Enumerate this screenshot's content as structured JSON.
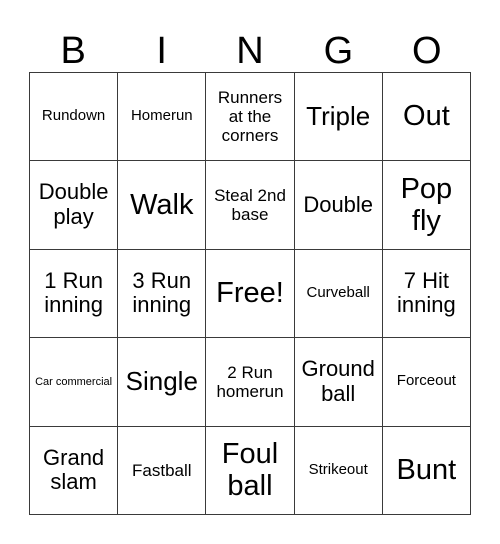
{
  "card": {
    "title": "BINGO",
    "header_letters": [
      "B",
      "I",
      "N",
      "G",
      "O"
    ],
    "colors": {
      "background": "#ffffff",
      "border": "#3a3a3a",
      "text": "#000000"
    },
    "grid_size": "5x5",
    "free_space": "Free!",
    "cells": [
      {
        "label": "Rundown",
        "size": "sm",
        "row": 1,
        "col": 1
      },
      {
        "label": "Homerun",
        "size": "sm",
        "row": 1,
        "col": 2
      },
      {
        "label": "Runners at the corners",
        "size": "md",
        "row": 1,
        "col": 3
      },
      {
        "label": "Triple",
        "size": "xl",
        "row": 1,
        "col": 4
      },
      {
        "label": "Out",
        "size": "xxl",
        "row": 1,
        "col": 5
      },
      {
        "label": "Double play",
        "size": "lg",
        "row": 2,
        "col": 1
      },
      {
        "label": "Walk",
        "size": "xxl",
        "row": 2,
        "col": 2
      },
      {
        "label": "Steal 2nd base",
        "size": "md",
        "row": 2,
        "col": 3
      },
      {
        "label": "Double",
        "size": "lg",
        "row": 2,
        "col": 4
      },
      {
        "label": "Pop fly",
        "size": "xxl",
        "row": 2,
        "col": 5
      },
      {
        "label": "1 Run inning",
        "size": "lg",
        "row": 3,
        "col": 1
      },
      {
        "label": "3 Run inning",
        "size": "lg",
        "row": 3,
        "col": 2
      },
      {
        "label": "Free!",
        "size": "xxl",
        "row": 3,
        "col": 3
      },
      {
        "label": "Curveball",
        "size": "sm",
        "row": 3,
        "col": 4
      },
      {
        "label": "7 Hit inning",
        "size": "lg",
        "row": 3,
        "col": 5
      },
      {
        "label": "Car commercial",
        "size": "xs",
        "row": 4,
        "col": 1
      },
      {
        "label": "Single",
        "size": "xl",
        "row": 4,
        "col": 2
      },
      {
        "label": "2 Run homerun",
        "size": "md",
        "row": 4,
        "col": 3
      },
      {
        "label": "Ground ball",
        "size": "lg",
        "row": 4,
        "col": 4
      },
      {
        "label": "Forceout",
        "size": "sm",
        "row": 4,
        "col": 5
      },
      {
        "label": "Grand slam",
        "size": "lg",
        "row": 5,
        "col": 1
      },
      {
        "label": "Fastball",
        "size": "md",
        "row": 5,
        "col": 2
      },
      {
        "label": "Foul ball",
        "size": "xxl",
        "row": 5,
        "col": 3
      },
      {
        "label": "Strikeout",
        "size": "sm",
        "row": 5,
        "col": 4
      },
      {
        "label": "Bunt",
        "size": "xxl",
        "row": 5,
        "col": 5
      }
    ]
  }
}
